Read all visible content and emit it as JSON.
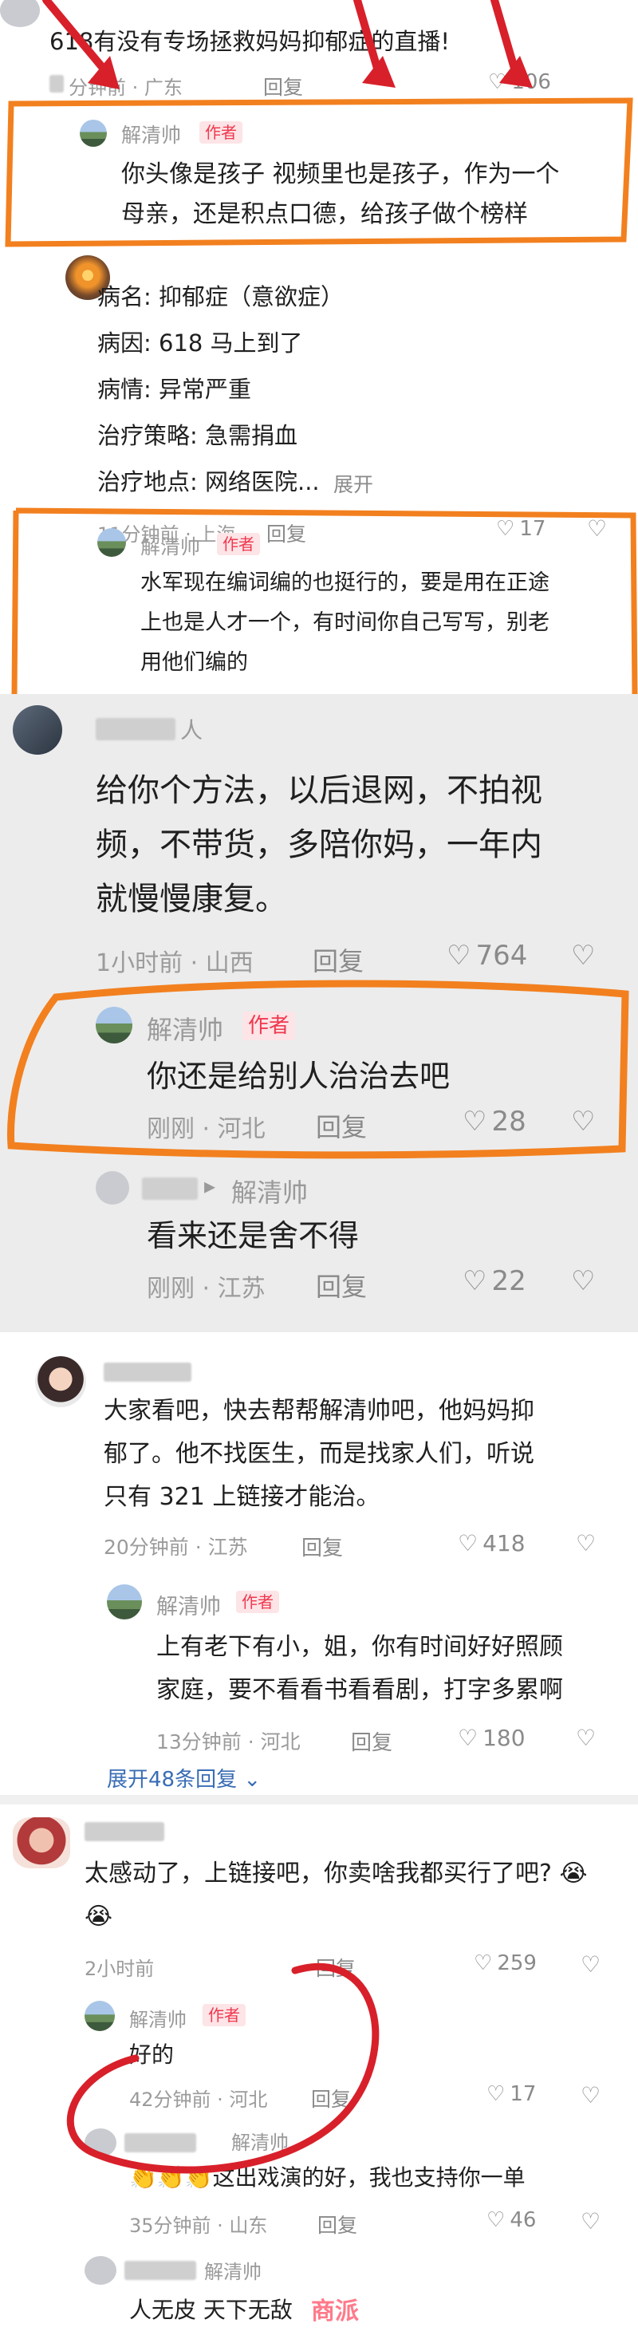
{
  "panel1": {
    "top_comment": {
      "text": "618有没有专场拯救妈妈抑郁症的直播!",
      "time": "分钟前 · 广东",
      "reply": "回复",
      "likes": "106"
    },
    "author_reply": {
      "name": "解清帅",
      "badge": "作者",
      "lines": [
        "你头像是孩子 视频里也是孩子，作为一个",
        "母亲，还是积点口德，给孩子做个榜样"
      ]
    }
  },
  "panel2": {
    "comment": {
      "lines": [
        "病名: 抑郁症（意欲症）",
        "病因: 618 马上到了",
        "病情: 异常严重",
        "治疗策略: 急需捐血",
        "治疗地点: 网络医院..."
      ],
      "expand": "展开",
      "time": "11分钟前 · 上海",
      "reply": "回复",
      "likes": "17"
    },
    "author_reply": {
      "name": "解清帅",
      "badge": "作者",
      "lines": [
        "水军现在编词编的也挺行的，要是用在正途",
        "上也是人才一个，有时间你自己写写，别老",
        "用他们编的"
      ]
    }
  },
  "panel3": {
    "comment": {
      "name_suffix": "人",
      "lines": [
        "给你个方法，以后退网，不拍视",
        "频，不带货，多陪你妈，一年内",
        "就慢慢康复。"
      ],
      "time": "1小时前 · 山西",
      "reply": "回复",
      "likes": "764"
    },
    "author_reply": {
      "name": "解清帅",
      "badge": "作者",
      "text": "你还是给别人治治去吧",
      "time": "刚刚 · 河北",
      "reply": "回复",
      "likes": "28"
    },
    "sub_reply": {
      "arrow": "▸",
      "target": "解清帅",
      "text": "看来还是舍不得",
      "time": "刚刚 · 江苏",
      "reply": "回复",
      "likes": "22"
    }
  },
  "panel4": {
    "comment": {
      "lines": [
        "大家看吧，快去帮帮解清帅吧，他妈妈抑",
        "郁了。他不找医生，而是找家人们，听说",
        "只有 321 上链接才能治。"
      ],
      "time": "20分钟前 · 江苏",
      "reply": "回复",
      "likes": "418"
    },
    "author_reply": {
      "name": "解清帅",
      "badge": "作者",
      "lines": [
        "上有老下有小，姐，你有时间好好照顾",
        "家庭，要不看看书看看剧，打字多累啊"
      ],
      "time": "13分钟前 · 河北",
      "reply": "回复",
      "likes": "180"
    },
    "expand_more": "展开48条回复"
  },
  "panel5": {
    "comment": {
      "lines": [
        "太感动了，上链接吧，你卖啥我都买行了吧? 😭",
        "😭"
      ],
      "time": "2小时前",
      "reply": "回复",
      "likes": "259"
    },
    "author_reply": {
      "name": "解清帅",
      "badge": "作者",
      "text": "好的",
      "time": "42分钟前 · 河北",
      "reply": "回复",
      "likes": "17"
    },
    "sub_reply1": {
      "target": "解清帅",
      "text": "👏👏👏这出戏演的好，我也支持你一单",
      "time": "35分钟前 · 山东",
      "reply": "回复",
      "likes": "46"
    },
    "sub_reply2": {
      "target": "解清帅",
      "text": "人无皮 天下无敌",
      "watermark": "商派"
    }
  },
  "colors": {
    "accent_orange": "#f2801f",
    "annotation_red": "#d8202a",
    "author_badge": "#f0384f",
    "expand_blue": "#3a6db5"
  }
}
